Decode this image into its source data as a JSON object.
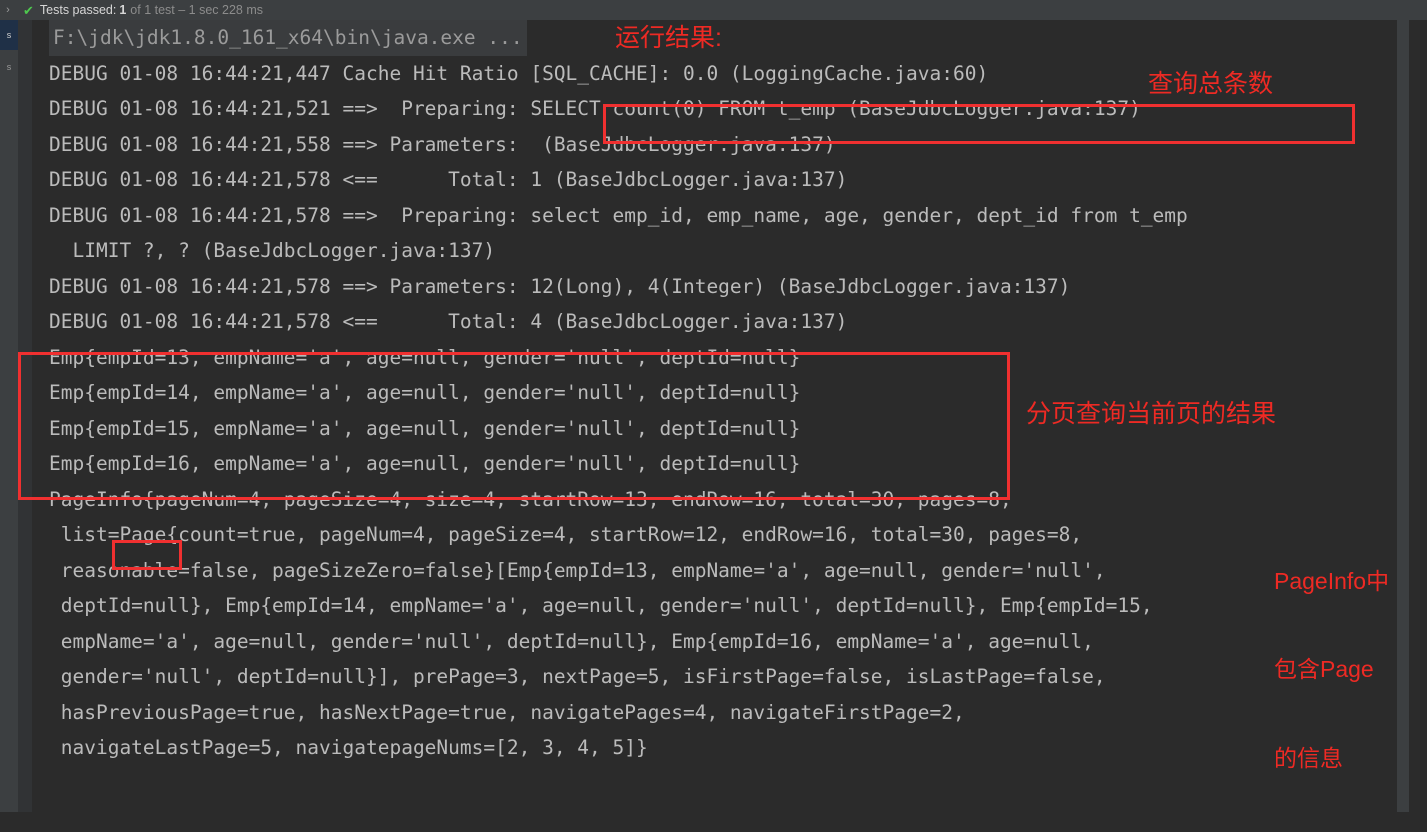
{
  "statusbar": {
    "chevron_icon": "chevron-right-icon",
    "check_icon": "check-mark-icon",
    "main": "Tests passed:",
    "count": "1",
    "dim": "of 1 test – 1 sec 228 ms"
  },
  "sidebar": {
    "tabs": [
      {
        "label": "s",
        "active": true
      },
      {
        "label": "s",
        "active": false
      }
    ]
  },
  "console": {
    "lines": [
      "F:\\jdk\\jdk1.8.0_161_x64\\bin\\java.exe ...",
      "DEBUG 01-08 16:44:21,447 Cache Hit Ratio [SQL_CACHE]: 0.0 (LoggingCache.java:60)",
      "DEBUG 01-08 16:44:21,521 ==>  Preparing: SELECT count(0) FROM t_emp (BaseJdbcLogger.java:137)",
      "DEBUG 01-08 16:44:21,558 ==> Parameters:  (BaseJdbcLogger.java:137)",
      "DEBUG 01-08 16:44:21,578 <==      Total: 1 (BaseJdbcLogger.java:137)",
      "DEBUG 01-08 16:44:21,578 ==>  Preparing: select emp_id, emp_name, age, gender, dept_id from t_emp",
      "  LIMIT ?, ? (BaseJdbcLogger.java:137)",
      "DEBUG 01-08 16:44:21,578 ==> Parameters: 12(Long), 4(Integer) (BaseJdbcLogger.java:137)",
      "DEBUG 01-08 16:44:21,578 <==      Total: 4 (BaseJdbcLogger.java:137)",
      "Emp{empId=13, empName='a', age=null, gender='null', deptId=null}",
      "Emp{empId=14, empName='a', age=null, gender='null', deptId=null}",
      "Emp{empId=15, empName='a', age=null, gender='null', deptId=null}",
      "Emp{empId=16, empName='a', age=null, gender='null', deptId=null}",
      "PageInfo{pageNum=4, pageSize=4, size=4, startRow=13, endRow=16, total=30, pages=8,",
      " list=Page{count=true, pageNum=4, pageSize=4, startRow=12, endRow=16, total=30, pages=8,",
      " reasonable=false, pageSizeZero=false}[Emp{empId=13, empName='a', age=null, gender='null',",
      " deptId=null}, Emp{empId=14, empName='a', age=null, gender='null', deptId=null}, Emp{empId=15,",
      " empName='a', age=null, gender='null', deptId=null}, Emp{empId=16, empName='a', age=null,",
      " gender='null', deptId=null}], prePage=3, nextPage=5, isFirstPage=false, isLastPage=false,",
      " hasPreviousPage=true, hasNextPage=true, navigatePages=4, navigateFirstPage=2,",
      " navigateLastPage=5, navigatepageNums=[2, 3, 4, 5]}"
    ]
  },
  "annotations": {
    "result": "运行结果:",
    "count_total": "查询总条数",
    "paging_result": "分页查询当前页的结果",
    "pageinfo_line1": "PageInfo中",
    "pageinfo_line2": "包含Page",
    "pageinfo_line3": "的信息"
  },
  "colors": {
    "annotation_red": "#ee2a24",
    "box_red": "#f03030",
    "console_bg": "#2b2b2b",
    "console_text": "#bbbbbb",
    "statusbar_bg": "#3c3f41",
    "check_green": "#4ec94e"
  }
}
